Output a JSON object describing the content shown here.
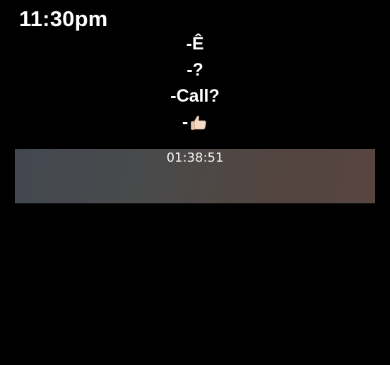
{
  "status": {
    "time": "11:30pm"
  },
  "messages": [
    {
      "text": "-Ê"
    },
    {
      "text": "-?"
    },
    {
      "text": "-Call?"
    },
    {
      "text": "-",
      "icon": "thumbs-up-icon"
    }
  ],
  "call": {
    "duration": "01:38:51"
  },
  "colors": {
    "background": "#000000",
    "text": "#ffffff",
    "call_bar": "#4a4a4a"
  }
}
